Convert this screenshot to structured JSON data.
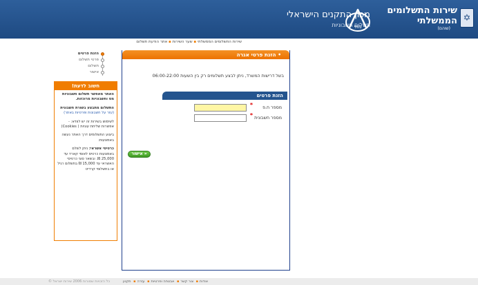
{
  "header": {
    "gov_title_line1": "שירות התשלומים",
    "gov_title_line2": "הממשלתי",
    "gov_subtitle": "(שוהם)",
    "institute_title": "מכון התקנים הישראלי",
    "institute_subtitle": "תשלום חשבוניות",
    "institute_logo_text": "מתי",
    "brand_color": "#1e4a82"
  },
  "breadcrumb": {
    "items": [
      "שירות התשלומים הממשלתי",
      "שער השירות",
      "אתר הודעת תשלום"
    ]
  },
  "steps": {
    "items": [
      {
        "label": "הזנת פרטים",
        "active": true
      },
      {
        "label": "פרטי תשלום",
        "active": false
      },
      {
        "label": "תשלום",
        "active": false
      },
      {
        "label": "אישור",
        "active": false
      }
    ]
  },
  "info_box": {
    "title": "חשוב לדעת!",
    "p1": "האתר מאפשר תשלום חשבוניות מס וחשבוניות מרוכזות.",
    "p2_bold": "התשלום מתבצע בשורת חשבונית",
    "p2_link": "(עזר על חשבונות ופרטיות באתר)",
    "p3": "לשימוש בשירות זה יש לוודא: - אפשרות שליחת עוגיות ( Cookies)",
    "p4": "ביצוע התשלומים דרך האתר נעשה באמצעות:",
    "p5_bold": "כרטיסי אשראי:",
    "p5": "ניתן לשלם באמצעות כרטיס לאומי קארד עד 25,000 ₪. ובשאר סוגי כרטיסי האשראי עד 15,000 ₪ בתשלום רגיל או בתשלומי קרדיט"
  },
  "main": {
    "title": "הזנת פרטי אגרה",
    "notice": "בשל דרישות המשרד, ניתן לבצע תשלומים רק בין השעות 06:00-22:00",
    "form_title": "הזנת פרטים",
    "field_id_label": "מספר ח.פ",
    "field_id_value": "",
    "field_account_label": "מספר חשבונית",
    "field_account_value": "",
    "approve_label": "« אישור",
    "accent_color": "#f07d00"
  },
  "footer": {
    "links": [
      "אודות",
      "צור קשר",
      "אבטחה ופרטיות",
      "עזרה",
      "תקנון"
    ],
    "copyright": "כל הזכויות שמורות 2006 שירות ישראל ©"
  }
}
